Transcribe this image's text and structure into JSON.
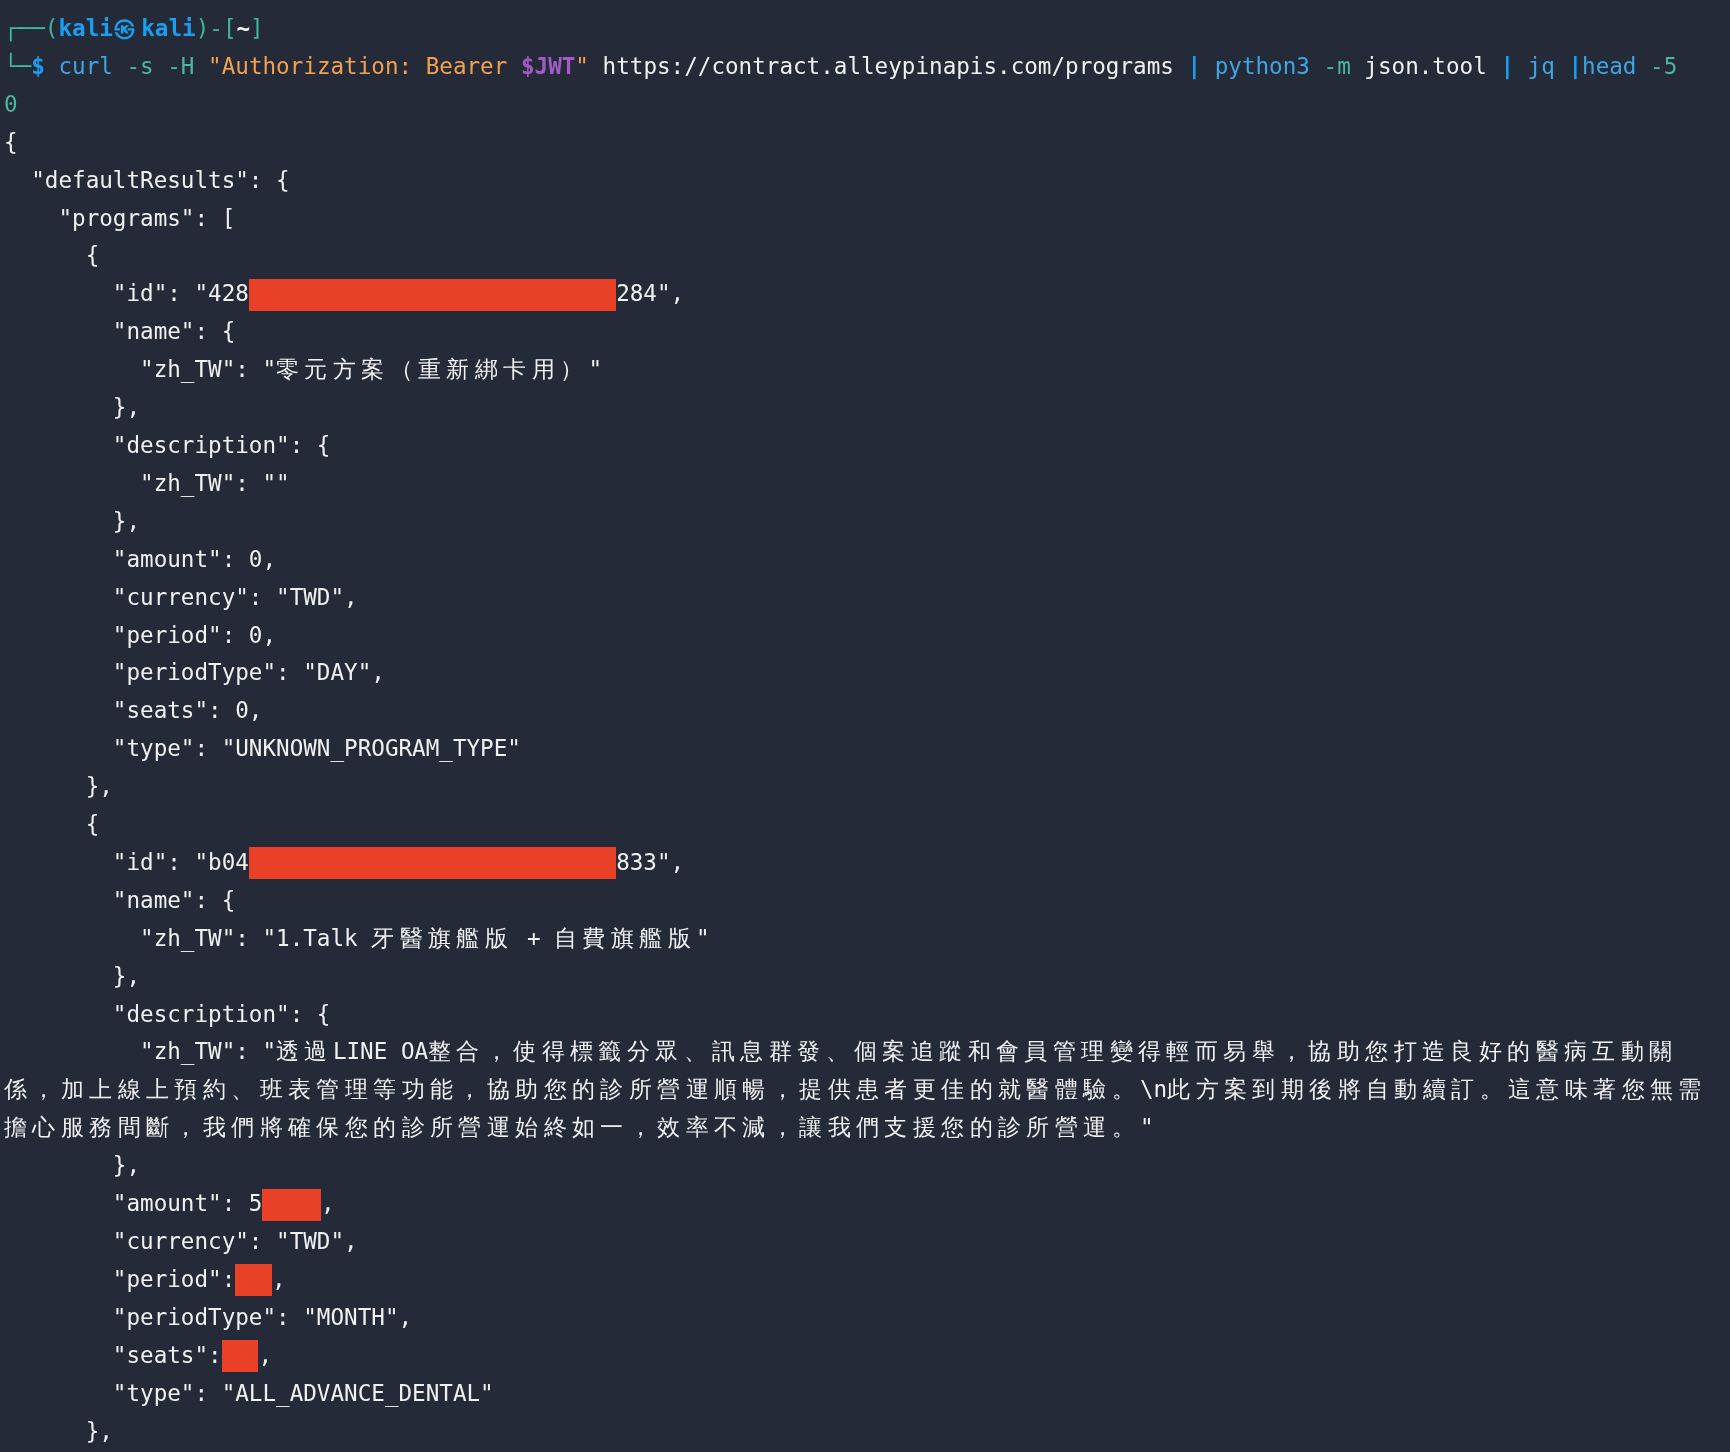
{
  "terminal": {
    "lines": [
      {
        "segments": [
          {
            "kind": "frame",
            "text": "┌──("
          },
          {
            "kind": "host",
            "text": "kali㉿kali"
          },
          {
            "kind": "frame",
            "text": ")-["
          },
          {
            "kind": "path",
            "text": "~"
          },
          {
            "kind": "frame",
            "text": "]"
          }
        ]
      },
      {
        "segments": [
          {
            "kind": "frame",
            "text": "└─"
          },
          {
            "kind": "prompt",
            "text": "$"
          },
          {
            "kind": "command",
            "text": " curl"
          },
          {
            "kind": "option",
            "text": " -s -H"
          },
          {
            "kind": "string",
            "text": " \"Authorization: Bearer "
          },
          {
            "kind": "variable",
            "text": "$JWT"
          },
          {
            "kind": "string",
            "text": "\""
          },
          {
            "kind": "plain",
            "text": " https://contract.alleypinapis.com/programs"
          },
          {
            "kind": "pipe",
            "text": " |"
          },
          {
            "kind": "command",
            "text": " python3"
          },
          {
            "kind": "option",
            "text": " -m"
          },
          {
            "kind": "plain",
            "text": " json.tool"
          },
          {
            "kind": "pipe",
            "text": " |"
          },
          {
            "kind": "command",
            "text": " jq"
          },
          {
            "kind": "pipe",
            "text": " |"
          },
          {
            "kind": "command",
            "text": "head"
          },
          {
            "kind": "option",
            "text": " -5"
          }
        ]
      },
      {
        "segments": [
          {
            "kind": "output",
            "text": "0"
          }
        ]
      },
      {
        "segments": [
          {
            "kind": "plain",
            "text": "{"
          }
        ]
      },
      {
        "segments": [
          {
            "kind": "plain",
            "text": "  \"defaultResults\": {"
          }
        ]
      },
      {
        "segments": [
          {
            "kind": "plain",
            "text": "    \"programs\": ["
          }
        ]
      },
      {
        "segments": [
          {
            "kind": "plain",
            "text": "      {"
          }
        ]
      },
      {
        "segments": [
          {
            "kind": "plain",
            "text": "        \"id\": \"428"
          },
          {
            "kind": "redaction"
          },
          {
            "kind": "plain",
            "text": "284\","
          }
        ]
      },
      {
        "segments": [
          {
            "kind": "plain",
            "text": "        \"name\": {"
          }
        ]
      },
      {
        "segments": [
          {
            "kind": "plain",
            "text": "          \"zh_TW\": \"零元方案（重新綁卡用）\""
          }
        ]
      },
      {
        "segments": [
          {
            "kind": "plain",
            "text": "        },"
          }
        ]
      },
      {
        "segments": [
          {
            "kind": "plain",
            "text": "        \"description\": {"
          }
        ]
      },
      {
        "segments": [
          {
            "kind": "plain",
            "text": "          \"zh_TW\": \"\""
          }
        ]
      },
      {
        "segments": [
          {
            "kind": "plain",
            "text": "        },"
          }
        ]
      },
      {
        "segments": [
          {
            "kind": "plain",
            "text": "        \"amount\": 0,"
          }
        ]
      },
      {
        "segments": [
          {
            "kind": "plain",
            "text": "        \"currency\": \"TWD\","
          }
        ]
      },
      {
        "segments": [
          {
            "kind": "plain",
            "text": "        \"period\": 0,"
          }
        ]
      },
      {
        "segments": [
          {
            "kind": "plain",
            "text": "        \"periodType\": \"DAY\","
          }
        ]
      },
      {
        "segments": [
          {
            "kind": "plain",
            "text": "        \"seats\": 0,"
          }
        ]
      },
      {
        "segments": [
          {
            "kind": "plain",
            "text": "        \"type\": \"UNKNOWN_PROGRAM_TYPE\""
          }
        ]
      },
      {
        "segments": [
          {
            "kind": "plain",
            "text": "      },"
          }
        ]
      },
      {
        "segments": [
          {
            "kind": "plain",
            "text": "      {"
          }
        ]
      },
      {
        "segments": [
          {
            "kind": "plain",
            "text": "        \"id\": \"b04"
          },
          {
            "kind": "redaction"
          },
          {
            "kind": "plain",
            "text": "833\","
          }
        ]
      },
      {
        "segments": [
          {
            "kind": "plain",
            "text": "        \"name\": {"
          }
        ]
      },
      {
        "segments": [
          {
            "kind": "plain",
            "text": "          \"zh_TW\": \"1.Talk 牙醫旗艦版 + 自費旗艦版\""
          }
        ]
      },
      {
        "segments": [
          {
            "kind": "plain",
            "text": "        },"
          }
        ]
      },
      {
        "segments": [
          {
            "kind": "plain",
            "text": "        \"description\": {"
          }
        ]
      },
      {
        "segments": [
          {
            "kind": "plain",
            "text": "          \"zh_TW\": \"透過LINE OA整合，使得標籤分眾、訊息群發、個案追蹤和會員管理變得輕而易舉，協助您打造良好的醫病互動關係，加上線上預約、班表管理等功能，協助您的診所營運順暢，提供患者更佳的就醫體驗。\\n此方案到期後將自動續訂。這意味著您無需擔心服務間斷，我們將確保您的診所營運始終如一，效率不減，讓我們支援您的診所營運。\""
          }
        ]
      },
      {
        "segments": [
          {
            "kind": "plain",
            "text": "        },"
          }
        ]
      },
      {
        "segments": [
          {
            "kind": "plain",
            "text": "        \"amount\": 5"
          },
          {
            "kind": "mask"
          },
          {
            "kind": "plain",
            "text": ","
          }
        ]
      },
      {
        "segments": [
          {
            "kind": "plain",
            "text": "        \"currency\": \"TWD\","
          }
        ]
      },
      {
        "segments": [
          {
            "kind": "plain",
            "text": "        \"period\":"
          },
          {
            "kind": "blot"
          },
          {
            "kind": "plain",
            "text": ","
          }
        ]
      },
      {
        "segments": [
          {
            "kind": "plain",
            "text": "        \"periodType\": \"MONTH\","
          }
        ]
      },
      {
        "segments": [
          {
            "kind": "plain",
            "text": "        \"seats\":"
          },
          {
            "kind": "blot"
          },
          {
            "kind": "plain",
            "text": ","
          }
        ]
      },
      {
        "segments": [
          {
            "kind": "plain",
            "text": "        \"type\": \"ALL_ADVANCE_DENTAL\""
          }
        ]
      },
      {
        "segments": [
          {
            "kind": "plain",
            "text": "      },"
          }
        ]
      }
    ]
  }
}
